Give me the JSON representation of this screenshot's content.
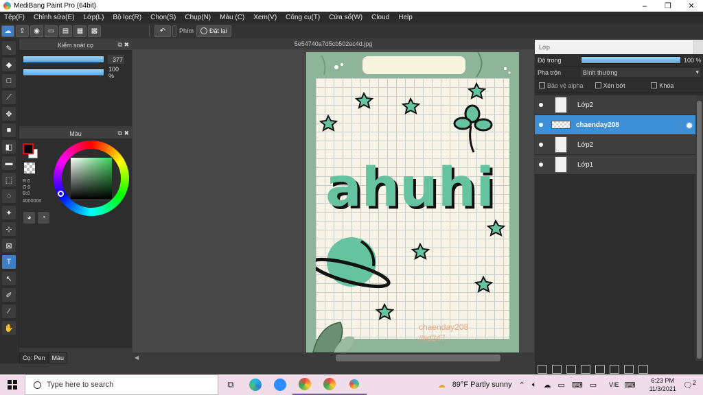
{
  "window": {
    "title": "MediBang Paint Pro (64bit)",
    "controls": [
      "–",
      "❐",
      "✕"
    ]
  },
  "menu": [
    "Tệp(F)",
    "Chỉnh sửa(E)",
    "Lớp(L)",
    "Bộ lọc(R)",
    "Chọn(S)",
    "Chụp(N)",
    "Màu (C)",
    "Xem(V)",
    "Công cụ(T)",
    "Cửa sổ(W)",
    "Cloud",
    "Help"
  ],
  "toolbar": {
    "shortcut_label": "Phím",
    "reset_label": "Đặt lại"
  },
  "brush_control": {
    "title": "Kiểm soát cọ",
    "size_value": "377",
    "opacity_value": "100 %"
  },
  "color_panel": {
    "title": "Màu",
    "rgb_text": "R:0\nG:0\nB:0",
    "hex_text": "#000000",
    "fg_color": "#000000",
    "bg_color": "#ffffff"
  },
  "bottom_tabs": [
    "Cọ: Pen",
    "Màu"
  ],
  "document": {
    "filename": "5e54740a7d5cb502ec4d.jpg",
    "artwork_text": "ahuhi",
    "signature_line1": "chaenday208",
    "signature_line2": "#lid247",
    "colors": {
      "mint": "#66c3a0",
      "frame": "#8eb49a",
      "paper": "#f7f4e7"
    }
  },
  "layers": {
    "title": "Lớp",
    "opacity_label": "Độ trong",
    "opacity_value": "100 %",
    "blend_label": "Pha trộn",
    "blend_value": "Bình thường",
    "options": [
      "Bảo vệ alpha",
      "Xén bớt",
      "Khóa"
    ],
    "items": [
      {
        "name": "Lớp2",
        "selected": false
      },
      {
        "name": "chaenday208",
        "selected": true
      },
      {
        "name": "Lớp2",
        "selected": false
      },
      {
        "name": "Lớp1",
        "selected": false
      }
    ]
  },
  "taskbar": {
    "search_placeholder": "Type here to search",
    "weather": "89°F  Partly sunny",
    "lang": "VIE",
    "time": "6:23 PM",
    "date": "11/3/2021",
    "notif_count": "2"
  }
}
